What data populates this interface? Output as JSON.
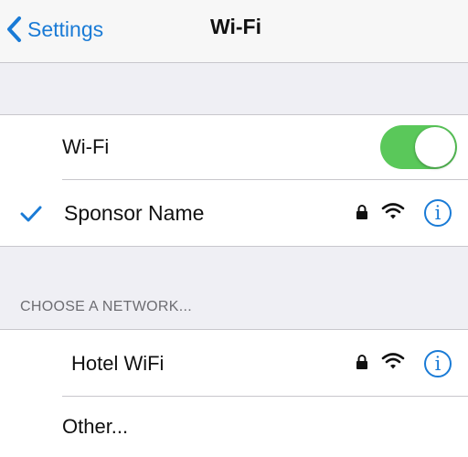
{
  "navbar": {
    "back_label": "Settings",
    "title": "Wi-Fi"
  },
  "wifi_toggle": {
    "label": "Wi-Fi",
    "enabled": true
  },
  "connected_network": {
    "name": "Sponsor Name",
    "checked": true,
    "icons": [
      "checkmark-icon",
      "lock-icon",
      "wifi-signal-icon",
      "info-icon"
    ]
  },
  "choose_section": {
    "header": "CHOOSE A NETWORK...",
    "networks": [
      {
        "name": "Hotel WiFi",
        "icons": [
          "lock-icon",
          "wifi-signal-icon",
          "info-icon"
        ]
      }
    ],
    "other_label": "Other..."
  },
  "colors": {
    "accent": "#1a7bd6",
    "toggle_on": "#5ac85a",
    "group_background": "#efeff4"
  }
}
